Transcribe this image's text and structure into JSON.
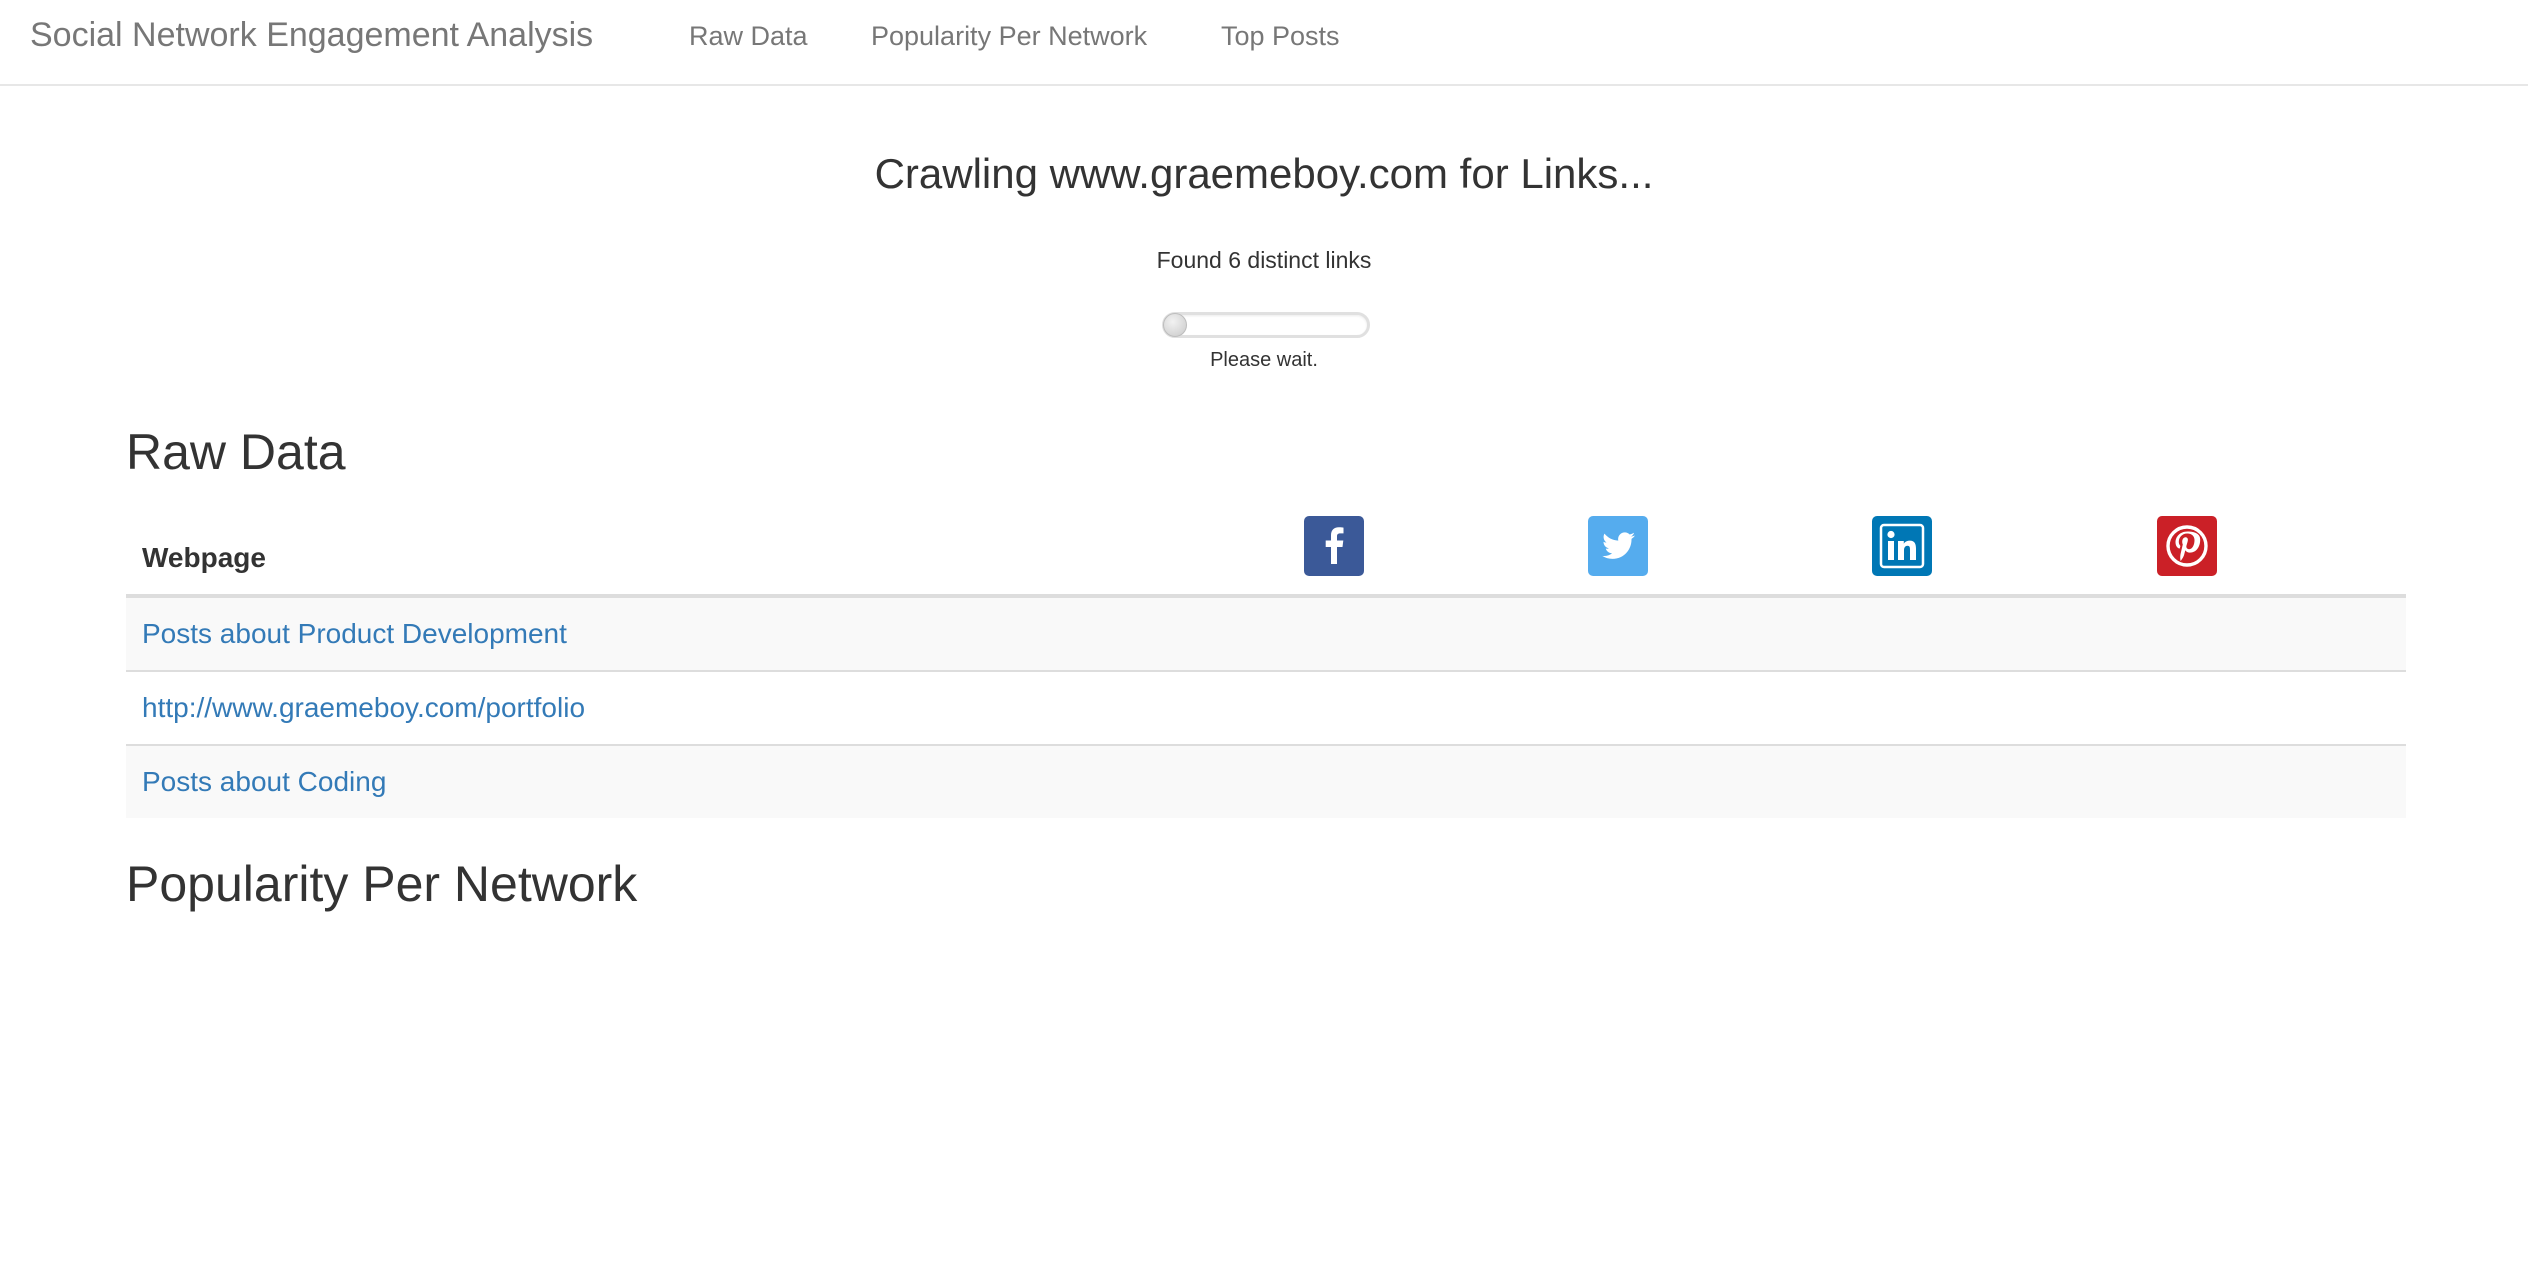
{
  "navbar": {
    "brand": "Social Network Engagement Analysis",
    "links": [
      {
        "label": "Raw Data"
      },
      {
        "label": "Popularity Per Network"
      },
      {
        "label": "Top Posts"
      }
    ]
  },
  "crawl": {
    "title": "Crawling www.graemeboy.com for Links...",
    "found_text": "Found 6 distinct links",
    "progress_percent": 0,
    "wait_text": "Please wait."
  },
  "raw_data": {
    "heading": "Raw Data",
    "column_header": "Webpage",
    "networks": [
      {
        "icon": "facebook-icon",
        "color": "#3b5998"
      },
      {
        "icon": "twitter-icon",
        "color": "#55acee"
      },
      {
        "icon": "linkedin-icon",
        "color": "#0077b5"
      },
      {
        "icon": "pinterest-icon",
        "color": "#cb2027"
      }
    ],
    "rows": [
      {
        "webpage": "Posts about Product Development"
      },
      {
        "webpage": "http://www.graemeboy.com/portfolio"
      },
      {
        "webpage": "Posts about Coding"
      }
    ]
  },
  "popularity": {
    "heading": "Popularity Per Network"
  },
  "colors": {
    "link": "#337ab7",
    "nav_text": "#777777",
    "text": "#333333"
  }
}
